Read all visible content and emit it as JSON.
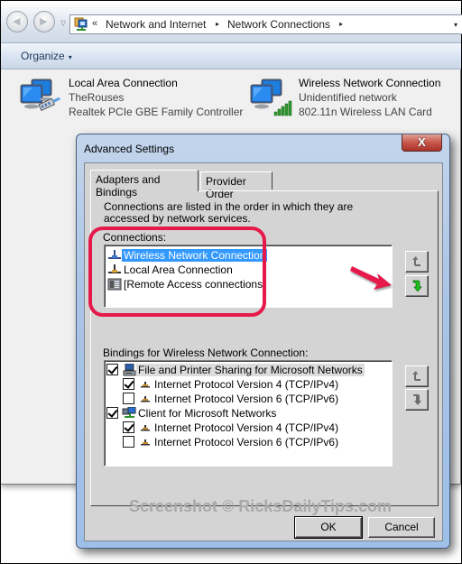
{
  "explorer": {
    "breadcrumb": {
      "overflow_glyph": "«",
      "items": [
        "Network and Internet",
        "Network Connections"
      ],
      "separator_glyph": "▸",
      "dropdown_glyph": "▾"
    },
    "toolbar": {
      "organize_label": "Organize",
      "organize_caret": "▾"
    },
    "connections": [
      {
        "name": "Local Area Connection",
        "network": "TheRouses",
        "device": "Realtek PCIe GBE Family Controller",
        "icon": "wired-monitor-icon"
      },
      {
        "name": "Wireless Network Connection",
        "network": "Unidentified network",
        "device": "802.11n Wireless LAN Card",
        "icon": "wireless-monitor-icon"
      }
    ]
  },
  "dialog": {
    "title": "Advanced Settings",
    "close_glyph": "X",
    "tabs": [
      {
        "label": "Adapters and Bindings",
        "active": true
      },
      {
        "label": "Provider Order",
        "active": false
      }
    ],
    "description": "Connections are listed in the order in which they are accessed by network services.",
    "connections_label": "Connections:",
    "connections": [
      {
        "label": "Wireless Network Connection",
        "icon": "network-adapter-icon",
        "selected": true
      },
      {
        "label": "Local Area Connection",
        "icon": "network-adapter-icon",
        "selected": false
      },
      {
        "label": "[Remote Access connections]",
        "icon": "phone-icon",
        "selected": false
      }
    ],
    "bindings_label": "Bindings for Wireless Network Connection:",
    "bindings": [
      {
        "label": "File and Printer Sharing for Microsoft Networks",
        "checked": true,
        "level": 0,
        "icon": "printer-computer-icon",
        "highlighted": true
      },
      {
        "label": "Internet Protocol Version 4 (TCP/IPv4)",
        "checked": true,
        "level": 1,
        "icon": "protocol-icon"
      },
      {
        "label": "Internet Protocol Version 6 (TCP/IPv6)",
        "checked": false,
        "level": 1,
        "icon": "protocol-icon"
      },
      {
        "label": "Client for Microsoft Networks",
        "checked": true,
        "level": 0,
        "icon": "network-client-icon"
      },
      {
        "label": "Internet Protocol Version 4 (TCP/IPv4)",
        "checked": true,
        "level": 1,
        "icon": "protocol-icon"
      },
      {
        "label": "Internet Protocol Version 6 (TCP/IPv6)",
        "checked": false,
        "level": 1,
        "icon": "protocol-icon"
      }
    ],
    "watermark": "Screenshot © RicksDailyTips.com",
    "ok_label": "OK",
    "cancel_label": "Cancel"
  },
  "annotation": {
    "highlight_color": "#e6194b"
  }
}
